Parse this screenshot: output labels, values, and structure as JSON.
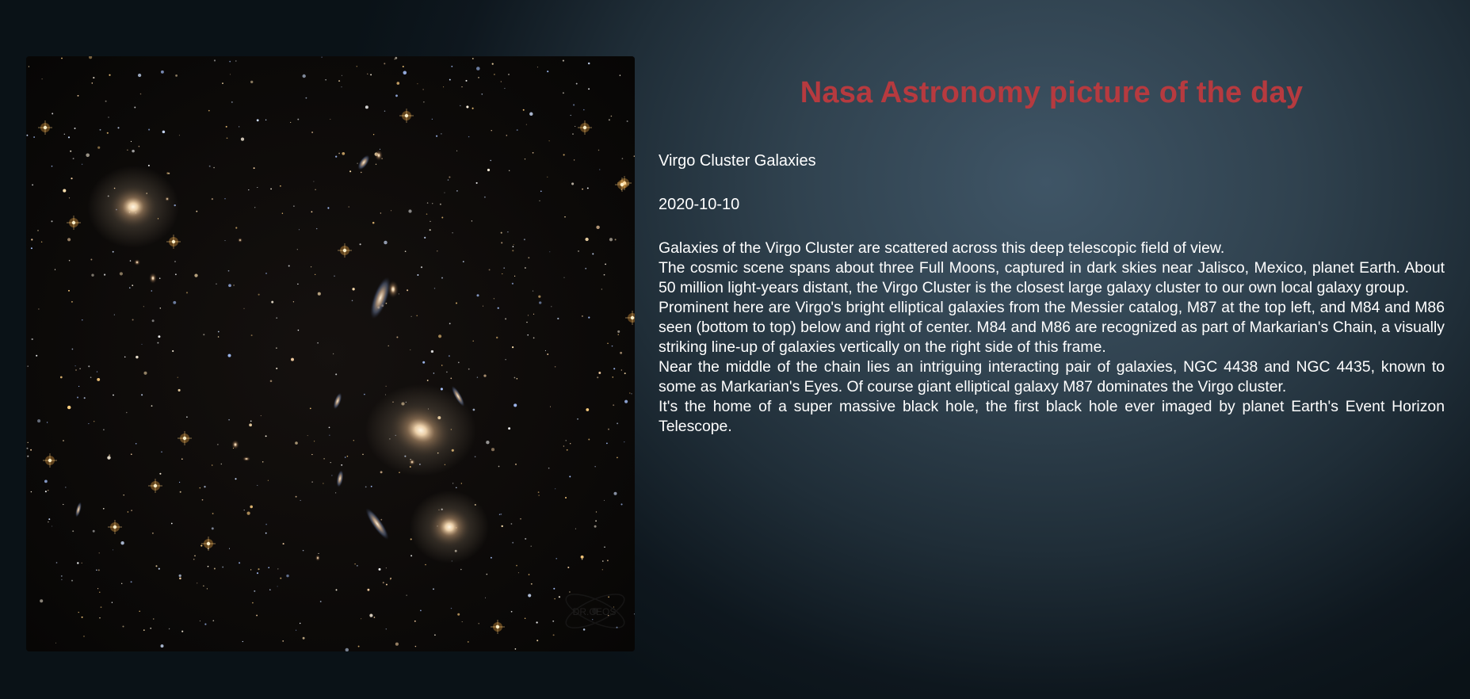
{
  "page": {
    "title": "Nasa Astronomy picture of the day"
  },
  "apod": {
    "title": "Virgo Cluster Galaxies",
    "date": "2020-10-10",
    "explanation": [
      "Galaxies of the Virgo Cluster are scattered across this deep telescopic field of view.",
      "The cosmic scene spans about three Full Moons, captured in dark skies near Jalisco, Mexico, planet Earth. About 50 million light-years distant, the Virgo Cluster is the closest large galaxy cluster to our own local galaxy group.",
      "Prominent here are Virgo's bright elliptical galaxies from the Messier catalog, M87 at the top left, and M84 and M86 seen (bottom to top) below and right of center. M84 and M86 are recognized as part of Markarian's Chain, a visually striking line-up of galaxies vertically on the right side of this frame.",
      "Near the middle of the chain lies an intriguing interacting pair of galaxies, NGC 4438 and NGC 4435, known to some as Markarian's Eyes. Of course giant elliptical galaxy M87 dominates the Virgo cluster.",
      "It's the home of a super massive black hole, the first black hole ever imaged by planet Earth's Event Horizon Telescope."
    ],
    "image_watermark": "DR.CEOS"
  },
  "colors": {
    "title_color": "#b63a3f",
    "text_color": "#ffffff"
  }
}
